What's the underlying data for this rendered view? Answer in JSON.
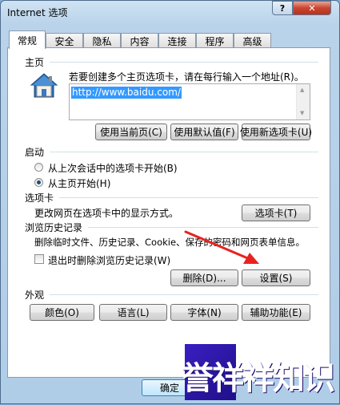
{
  "window": {
    "title": "Internet 选项",
    "help_label": "?",
    "close_label": "✕"
  },
  "tabs": [
    "常规",
    "安全",
    "隐私",
    "内容",
    "连接",
    "程序",
    "高级"
  ],
  "home": {
    "section_label": "主页",
    "description": "若要创建多个主页选项卡，请在每行输入一个地址(R)。",
    "url": "http://www.baidu.com/",
    "use_current": "使用当前页(C)",
    "use_default": "使用默认值(F)",
    "use_new_tab": "使用新选项卡(U)"
  },
  "startup": {
    "section_label": "启动",
    "option_last_session": "从上次会话中的选项卡开始(B)",
    "option_home": "从主页开始(H)",
    "selected": "从主页开始(H)"
  },
  "tabs_section": {
    "section_label": "选项卡",
    "description": "更改网页在选项卡中的显示方式。",
    "button": "选项卡(T)"
  },
  "history": {
    "section_label": "浏览历史记录",
    "description": "删除临时文件、历史记录、Cookie、保存的密码和网页表单信息。",
    "checkbox_label": "退出时删除浏览历史记录(W)",
    "checkbox_checked": false,
    "delete_button": "删除(D)...",
    "settings_button": "设置(S)"
  },
  "appearance": {
    "section_label": "外观",
    "colors": "颜色(O)",
    "languages": "语言(L)",
    "fonts": "字体(N)",
    "accessibility": "辅助功能(E)"
  },
  "footer": {
    "ok_label": "确定"
  },
  "watermark": {
    "text": "誉祥祥知识"
  },
  "colors": {
    "annotation_arrow": "#e8231f",
    "selection": "#3399ff"
  }
}
